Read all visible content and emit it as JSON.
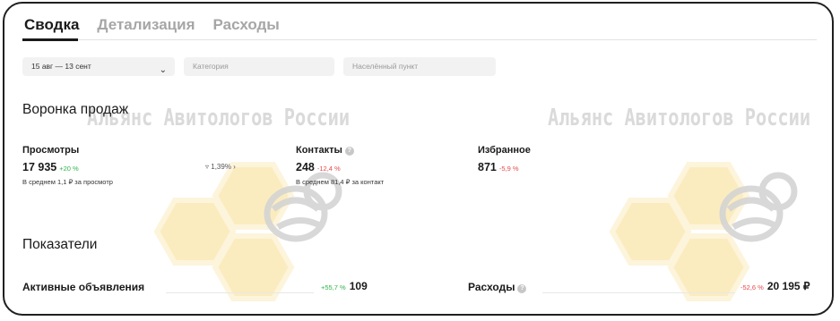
{
  "tabs": [
    "Сводка",
    "Детализация",
    "Расходы"
  ],
  "filters": {
    "date_value": "15 авг — 13 сент",
    "category_placeholder": "Категория",
    "city_placeholder": "Населённый пункт"
  },
  "funnel": {
    "title": "Воронка продаж",
    "views": {
      "label": "Просмотры",
      "value": "17 935",
      "delta": "+20 %",
      "sub": "В среднем 1,1 ₽ за просмотр"
    },
    "conversion": "1,39%",
    "contacts": {
      "label": "Контакты",
      "value": "248",
      "delta": "-12,4 %",
      "sub": "В среднем 81,4 ₽ за контакт"
    },
    "favorites": {
      "label": "Избранное",
      "value": "871",
      "delta": "-5,9 %"
    }
  },
  "indicators": {
    "title": "Показатели",
    "active": {
      "label": "Активные объявления",
      "delta": "+55,7 %",
      "value": "109"
    },
    "expenses": {
      "label": "Расходы",
      "delta": "-52,6 %",
      "value": "20 195 ₽"
    }
  },
  "watermark": {
    "text": "Альянс Авитологов России"
  },
  "colors": {
    "up": "#2fb34a",
    "down": "#e64a4a",
    "honey": "#fbe9b5"
  }
}
